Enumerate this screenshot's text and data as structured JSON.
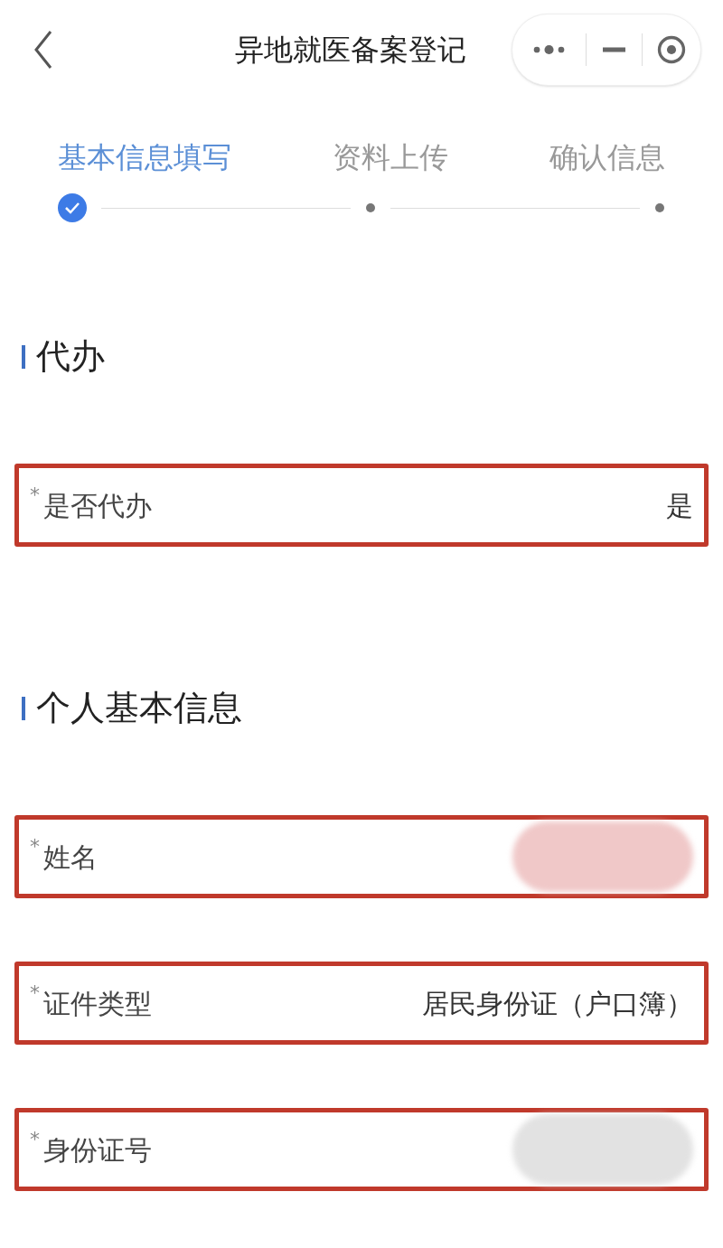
{
  "nav_bar": {
    "title": "异地就医备案登记"
  },
  "steps": [
    {
      "label": "基本信息填写",
      "selected": true,
      "done": true
    },
    {
      "label": "资料上传",
      "selected": false,
      "done": false
    },
    {
      "label": "确认信息",
      "selected": false,
      "done": false
    }
  ],
  "sections": [
    {
      "title": "代办",
      "fields": [
        {
          "required_mark": "*",
          "label": "是否代办",
          "kind": "text",
          "value": "是",
          "highlighted": true
        }
      ]
    },
    {
      "title": "个人基本信息",
      "fields": [
        {
          "required_mark": "*",
          "label": "姓名",
          "kind": "masked",
          "color": "#f0c8c8",
          "highlighted": true
        },
        {
          "required_mark": "*",
          "label": "证件类型",
          "kind": "text",
          "value": "居民身份证（户口簿）",
          "highlighted": true
        },
        {
          "required_mark": "*",
          "label": "身份证号",
          "kind": "masked",
          "color": "#e2e2e2",
          "highlighted": true
        }
      ]
    }
  ]
}
